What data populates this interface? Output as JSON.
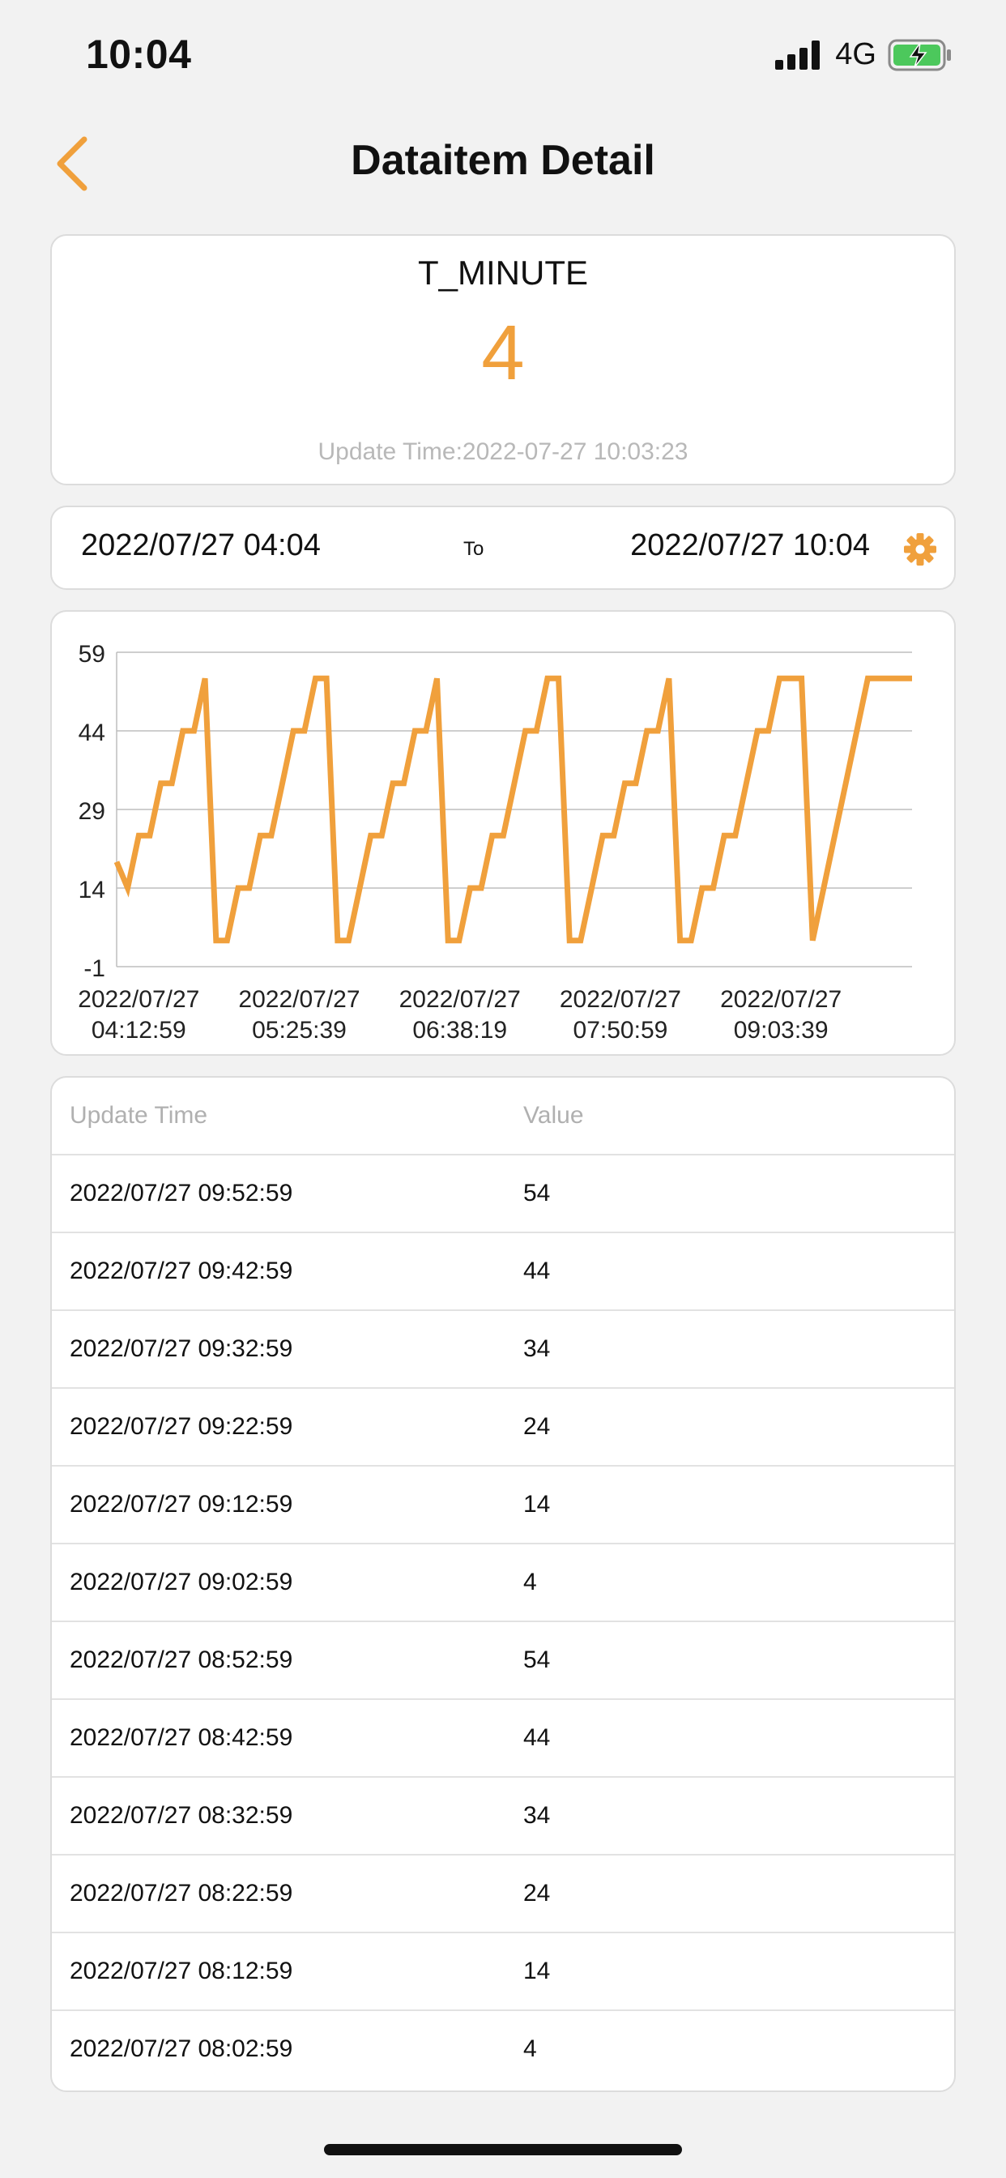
{
  "status_bar": {
    "time": "10:04",
    "network": "4G",
    "icons": [
      "signal-icon",
      "battery-charging-icon"
    ]
  },
  "nav": {
    "title": "Dataitem Detail",
    "back_icon": "chevron-left-icon"
  },
  "item": {
    "name": "T_MINUTE",
    "value": "4",
    "update_time": "Update Time:2022-07-27 10:03:23"
  },
  "range": {
    "start": "2022/07/27 04:04",
    "separator": "To",
    "end": "2022/07/27 10:04",
    "settings_icon": "gear-icon"
  },
  "colors": {
    "accent": "#f0a03c",
    "background": "#f2f2f2",
    "card": "#ffffff",
    "grid": "#bdbdbd",
    "muted_text": "#b8b8b8"
  },
  "chart_data": {
    "type": "line",
    "ylim": [
      -1,
      59
    ],
    "yticks": [
      59,
      44,
      29,
      14,
      -1
    ],
    "xlim": [
      "2022-07-27 04:02:59",
      "2022-07-27 10:02:59"
    ],
    "xtick_labels": [
      {
        "date": "2022/07/27",
        "time": "04:12:59"
      },
      {
        "date": "2022/07/27",
        "time": "05:25:39"
      },
      {
        "date": "2022/07/27",
        "time": "06:38:19"
      },
      {
        "date": "2022/07/27",
        "time": "07:50:59"
      },
      {
        "date": "2022/07/27",
        "time": "09:03:39"
      }
    ],
    "grid": true,
    "color": "#f0a03c",
    "series": [
      {
        "x": [
          "2022-07-27 04:02:59",
          "2022-07-27 04:07:59",
          "2022-07-27 04:12:59",
          "2022-07-27 04:17:59",
          "2022-07-27 04:22:59",
          "2022-07-27 04:27:59",
          "2022-07-27 04:32:59",
          "2022-07-27 04:37:59",
          "2022-07-27 04:42:59",
          "2022-07-27 04:47:59",
          "2022-07-27 04:52:59",
          "2022-07-27 04:57:59",
          "2022-07-27 05:02:59",
          "2022-07-27 05:07:59",
          "2022-07-27 05:12:59",
          "2022-07-27 05:17:59",
          "2022-07-27 05:22:59",
          "2022-07-27 05:27:59",
          "2022-07-27 05:32:59",
          "2022-07-27 05:37:59",
          "2022-07-27 05:42:59",
          "2022-07-27 05:47:59",
          "2022-07-27 05:52:59",
          "2022-07-27 05:57:59",
          "2022-07-27 06:02:59",
          "2022-07-27 06:07:59",
          "2022-07-27 06:12:59",
          "2022-07-27 06:17:59",
          "2022-07-27 06:22:59",
          "2022-07-27 06:27:59",
          "2022-07-27 06:32:59",
          "2022-07-27 06:37:59",
          "2022-07-27 06:42:59",
          "2022-07-27 06:47:59",
          "2022-07-27 06:52:59",
          "2022-07-27 06:57:59",
          "2022-07-27 07:02:59",
          "2022-07-27 07:07:59",
          "2022-07-27 07:12:59",
          "2022-07-27 07:17:59",
          "2022-07-27 07:22:59",
          "2022-07-27 07:27:59",
          "2022-07-27 07:32:59",
          "2022-07-27 07:37:59",
          "2022-07-27 07:42:59",
          "2022-07-27 07:47:59",
          "2022-07-27 07:52:59",
          "2022-07-27 07:57:59",
          "2022-07-27 08:02:59",
          "2022-07-27 08:07:59",
          "2022-07-27 08:12:59",
          "2022-07-27 08:17:59",
          "2022-07-27 08:22:59",
          "2022-07-27 08:27:59",
          "2022-07-27 08:32:59",
          "2022-07-27 08:37:59",
          "2022-07-27 08:42:59",
          "2022-07-27 08:47:59",
          "2022-07-27 08:52:59",
          "2022-07-27 08:57:59",
          "2022-07-27 09:02:59",
          "2022-07-27 09:07:59",
          "2022-07-27 09:12:59",
          "2022-07-27 09:17:59",
          "2022-07-27 09:22:59",
          "2022-07-27 09:27:59",
          "2022-07-27 09:32:59",
          "2022-07-27 09:37:59",
          "2022-07-27 09:42:59",
          "2022-07-27 09:47:59",
          "2022-07-27 09:52:59",
          "2022-07-27 09:57:59",
          "2022-07-27 10:02:59"
        ],
        "y": [
          19,
          14,
          24,
          24,
          34,
          34,
          44,
          44,
          54,
          4,
          4,
          14,
          14,
          24,
          24,
          34,
          44,
          44,
          54,
          54,
          4,
          4,
          14,
          24,
          24,
          34,
          34,
          44,
          44,
          54,
          4,
          4,
          14,
          14,
          24,
          24,
          34,
          44,
          44,
          54,
          54,
          4,
          4,
          14,
          24,
          24,
          34,
          34,
          44,
          44,
          54,
          4,
          4,
          14,
          14,
          24,
          24,
          34,
          44,
          44,
          54,
          54,
          54,
          4,
          14,
          24,
          34,
          44,
          54,
          54,
          54,
          54,
          54
        ]
      }
    ]
  },
  "table": {
    "headers": {
      "time": "Update Time",
      "value": "Value"
    },
    "rows": [
      {
        "time": "2022/07/27 09:52:59",
        "value": "54"
      },
      {
        "time": "2022/07/27 09:42:59",
        "value": "44"
      },
      {
        "time": "2022/07/27 09:32:59",
        "value": "34"
      },
      {
        "time": "2022/07/27 09:22:59",
        "value": "24"
      },
      {
        "time": "2022/07/27 09:12:59",
        "value": "14"
      },
      {
        "time": "2022/07/27 09:02:59",
        "value": "4"
      },
      {
        "time": "2022/07/27 08:52:59",
        "value": "54"
      },
      {
        "time": "2022/07/27 08:42:59",
        "value": "44"
      },
      {
        "time": "2022/07/27 08:32:59",
        "value": "34"
      },
      {
        "time": "2022/07/27 08:22:59",
        "value": "24"
      },
      {
        "time": "2022/07/27 08:12:59",
        "value": "14"
      },
      {
        "time": "2022/07/27 08:02:59",
        "value": "4"
      }
    ]
  }
}
